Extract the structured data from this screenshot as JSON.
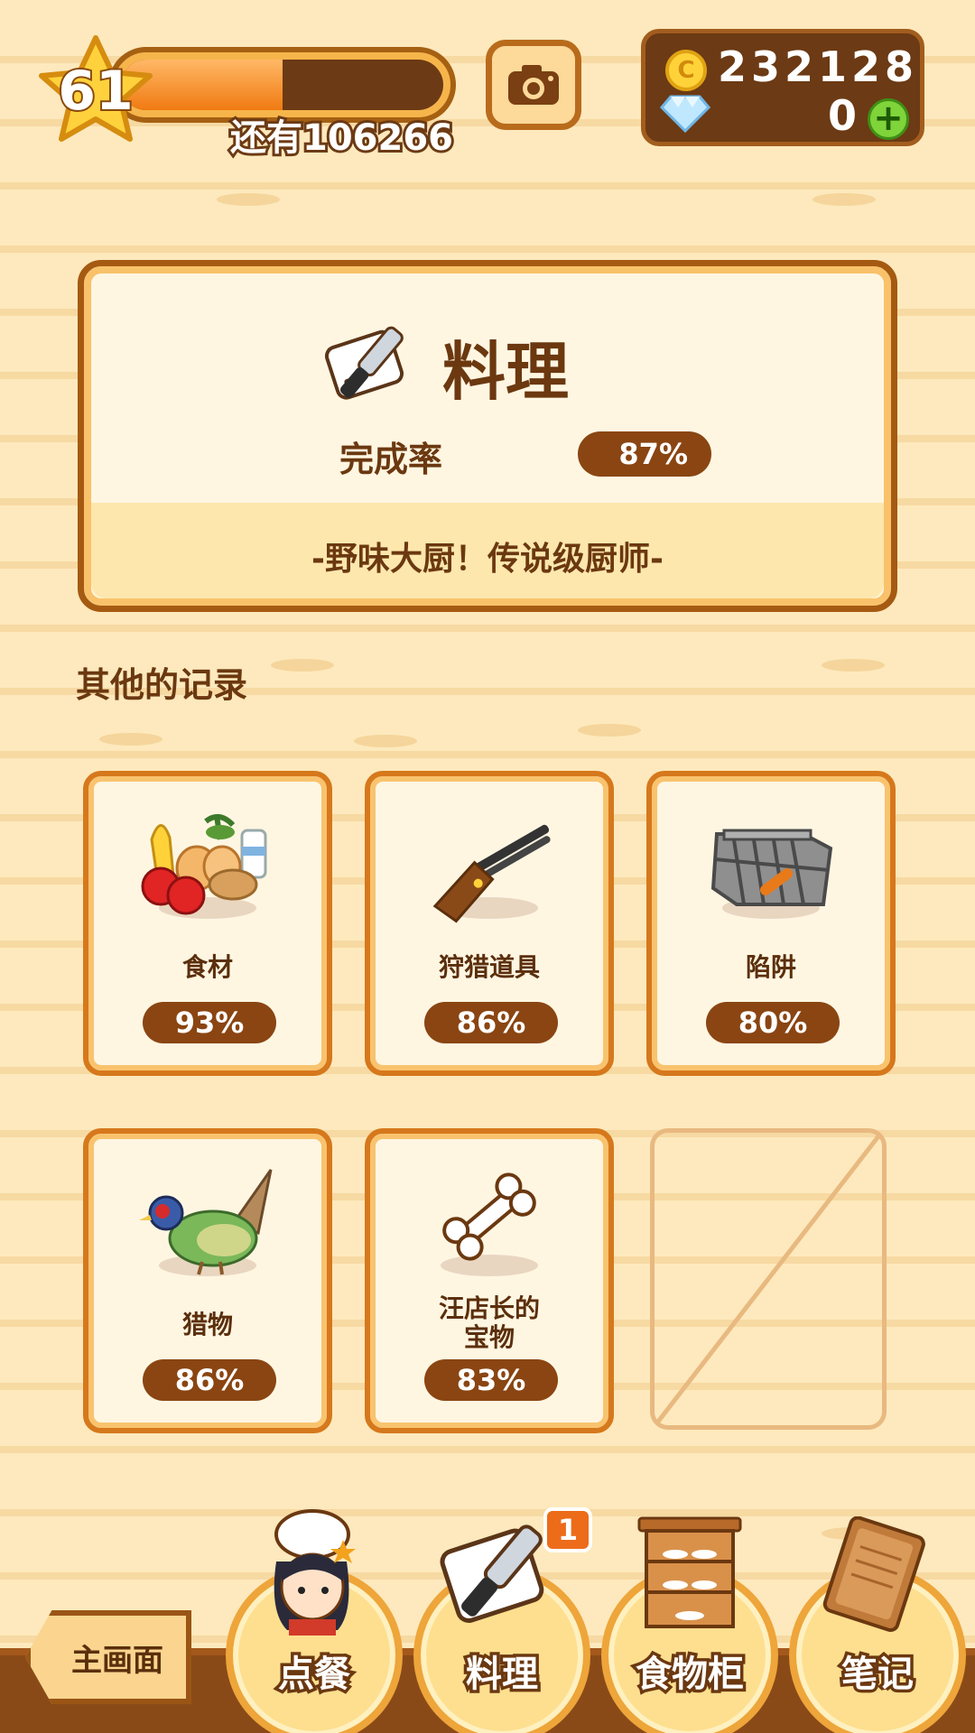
{
  "player": {
    "level": "61",
    "exp_progress": 0.5,
    "remaining_label": "还有106266"
  },
  "currency": {
    "coin_symbol": "C",
    "coins": "232128",
    "gems": "0"
  },
  "main_record": {
    "title": "料理",
    "completion_label": "完成率",
    "completion_value": "87%",
    "rank_title": "-野味大厨！传说级厨师-"
  },
  "other_records": {
    "title": "其他的记录",
    "items": [
      {
        "label": "食材",
        "value": "93%",
        "icon": "ingredients-icon"
      },
      {
        "label": "狩猎道具",
        "value": "86%",
        "icon": "rifle-icon"
      },
      {
        "label": "陷阱",
        "value": "80%",
        "icon": "cage-trap-icon"
      },
      {
        "label": "猎物",
        "value": "86%",
        "icon": "pheasant-icon"
      },
      {
        "label": "汪店长的\n宝物",
        "value": "83%",
        "icon": "bone-icon"
      }
    ]
  },
  "nav": {
    "home": "主画面",
    "order": "点餐",
    "cook": "料理",
    "cook_badge": "1",
    "pantry": "食物柜",
    "notes": "笔记"
  },
  "colors": {
    "brown": "#6b3810",
    "pill": "#8a4512",
    "orange_border": "#d6781c",
    "cream": "#fff6e2"
  }
}
